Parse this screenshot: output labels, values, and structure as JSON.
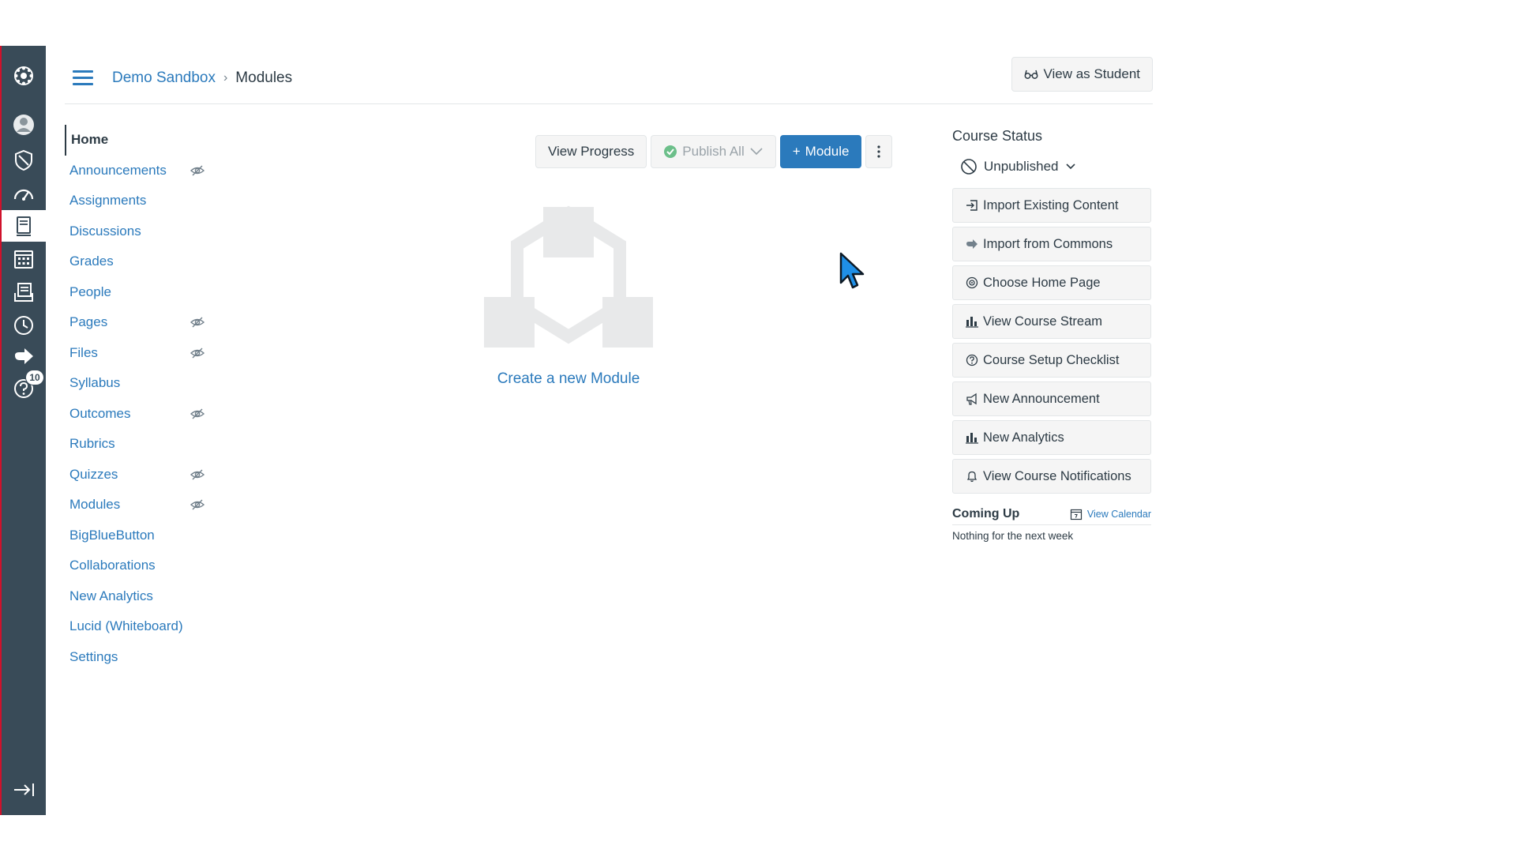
{
  "header": {
    "breadcrumb_course": "Demo Sandbox",
    "breadcrumb_separator": "›",
    "breadcrumb_current": "Modules",
    "view_as_student": "View as Student"
  },
  "global_nav": {
    "badge_count": "10",
    "items": [
      {
        "icon": "logo-icon"
      },
      {
        "icon": "account-icon"
      },
      {
        "icon": "admin-icon"
      },
      {
        "icon": "dashboard-icon"
      },
      {
        "icon": "courses-icon"
      },
      {
        "icon": "calendar-icon"
      },
      {
        "icon": "inbox-icon"
      },
      {
        "icon": "history-icon"
      },
      {
        "icon": "commons-icon"
      },
      {
        "icon": "help-icon"
      },
      {
        "icon": "collapse-nav-icon"
      }
    ]
  },
  "course_nav": {
    "items": [
      {
        "label": "Home",
        "hidden": false
      },
      {
        "label": "Announcements",
        "hidden": true
      },
      {
        "label": "Assignments",
        "hidden": false
      },
      {
        "label": "Discussions",
        "hidden": false
      },
      {
        "label": "Grades",
        "hidden": false
      },
      {
        "label": "People",
        "hidden": false
      },
      {
        "label": "Pages",
        "hidden": true
      },
      {
        "label": "Files",
        "hidden": true
      },
      {
        "label": "Syllabus",
        "hidden": false
      },
      {
        "label": "Outcomes",
        "hidden": true
      },
      {
        "label": "Rubrics",
        "hidden": false
      },
      {
        "label": "Quizzes",
        "hidden": true
      },
      {
        "label": "Modules",
        "hidden": true
      },
      {
        "label": "BigBlueButton",
        "hidden": false
      },
      {
        "label": "Collaborations",
        "hidden": false
      },
      {
        "label": "New Analytics",
        "hidden": false
      },
      {
        "label": "Lucid (Whiteboard)",
        "hidden": false
      },
      {
        "label": "Settings",
        "hidden": false
      }
    ]
  },
  "toolbar": {
    "view_progress": "View Progress",
    "publish_all": "Publish All",
    "add_module": "Module",
    "add_module_prefix": "+"
  },
  "main": {
    "create_module": "Create a new Module"
  },
  "sidebar": {
    "course_status": "Course Status",
    "status_value": "Unpublished",
    "actions": [
      {
        "label": "Import Existing Content",
        "icon": "import-icon"
      },
      {
        "label": "Import from Commons",
        "icon": "commons-icon"
      },
      {
        "label": "Choose Home Page",
        "icon": "target-icon"
      },
      {
        "label": "View Course Stream",
        "icon": "bar-chart-icon"
      },
      {
        "label": "Course Setup Checklist",
        "icon": "question-icon"
      },
      {
        "label": "New Announcement",
        "icon": "megaphone-icon"
      },
      {
        "label": "New Analytics",
        "icon": "bar-chart-icon"
      },
      {
        "label": "View Course Notifications",
        "icon": "bell-icon"
      }
    ],
    "coming_up": "Coming Up",
    "view_calendar": "View Calendar",
    "nothing_next": "Nothing for the next week"
  },
  "colors": {
    "nav_bg": "#394b58",
    "link": "#2b7abc",
    "brand_red": "#d0112b",
    "text": "#2d3b45"
  }
}
